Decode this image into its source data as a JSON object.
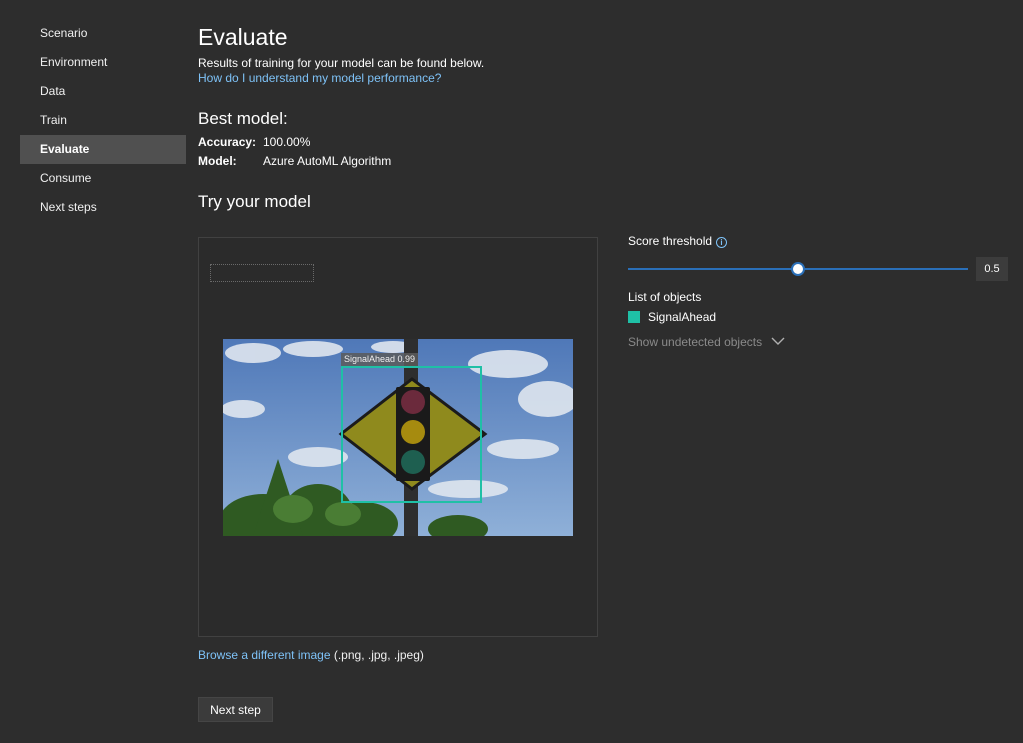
{
  "sidebar": {
    "items": [
      {
        "label": "Scenario"
      },
      {
        "label": "Environment"
      },
      {
        "label": "Data"
      },
      {
        "label": "Train"
      },
      {
        "label": "Evaluate"
      },
      {
        "label": "Consume"
      },
      {
        "label": "Next steps"
      }
    ],
    "active": "Evaluate"
  },
  "main": {
    "title": "Evaluate",
    "subtitle": "Results of training for your model can be found below.",
    "help_link": "How do I understand my model performance?",
    "best_model": {
      "title": "Best model:",
      "accuracy_label": "Accuracy:",
      "accuracy_value": "100.00%",
      "model_label": "Model:",
      "model_value": "Azure AutoML Algorithm"
    },
    "try_title": "Try your model",
    "detection": {
      "label": "SignalAhead 0.99",
      "box_color": "#1fc0a6"
    },
    "browse_link": "Browse a different image",
    "browse_suffix": " (.png, .jpg, .jpeg)",
    "next_button": "Next step"
  },
  "right": {
    "threshold_label": "Score threshold",
    "threshold_value": "0.5",
    "threshold_fraction": 0.5,
    "objects_label": "List of objects",
    "objects": [
      {
        "name": "SignalAhead",
        "color": "#1fc0a6"
      }
    ],
    "show_undetected": "Show undetected objects"
  },
  "colors": {
    "background": "#2d2d2d",
    "accent_link": "#7ec2f7",
    "slider": "#2a6fb8",
    "active_nav": "#505050"
  }
}
